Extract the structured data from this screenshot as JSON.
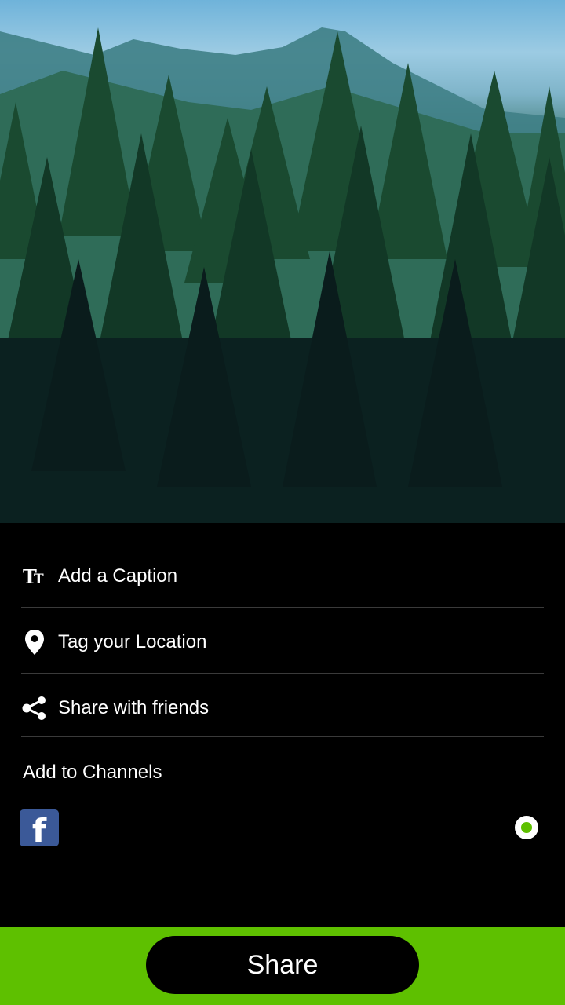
{
  "menu": {
    "caption": {
      "label": "Add a Caption",
      "icon": "text-size-icon"
    },
    "location": {
      "label": "Tag your Location",
      "icon": "location-pin-icon"
    },
    "friends": {
      "label": "Share with friends",
      "icon": "share-icon"
    }
  },
  "channels": {
    "title": "Add to Channels",
    "items": [
      {
        "icon": "facebook-icon",
        "glyph": "f",
        "selected": true
      }
    ]
  },
  "actions": {
    "share_label": "Share"
  },
  "colors": {
    "accent": "#5ec000",
    "background": "#000000",
    "facebook": "#3b5998",
    "divider": "#3a3a3a"
  }
}
